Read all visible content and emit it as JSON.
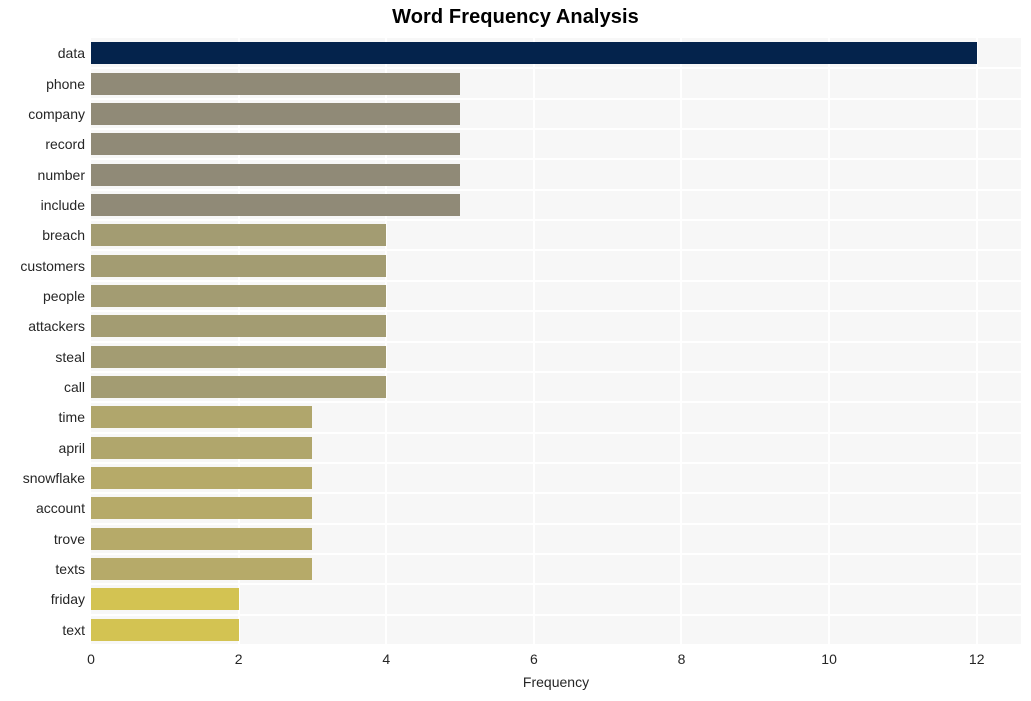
{
  "chart_data": {
    "type": "bar",
    "orientation": "horizontal",
    "title": "Word Frequency Analysis",
    "xlabel": "Frequency",
    "ylabel": "",
    "xlim": [
      0,
      12.6
    ],
    "xticks": [
      0,
      2,
      4,
      6,
      8,
      10,
      12
    ],
    "xtick_labels": [
      "0",
      "2",
      "4",
      "6",
      "8",
      "10",
      "12"
    ],
    "grid": true,
    "legend": null,
    "categories": [
      "data",
      "phone",
      "company",
      "record",
      "number",
      "include",
      "breach",
      "customers",
      "people",
      "attackers",
      "steal",
      "call",
      "time",
      "april",
      "snowflake",
      "account",
      "trove",
      "texts",
      "friday",
      "text"
    ],
    "values": [
      12,
      5,
      5,
      5,
      5,
      5,
      4,
      4,
      4,
      4,
      4,
      4,
      3,
      3,
      3,
      3,
      3,
      3,
      2,
      2
    ],
    "bar_colors": [
      "#04234c",
      "#908a77",
      "#908a77",
      "#908a77",
      "#908a77",
      "#908a77",
      "#a39c72",
      "#a39c72",
      "#a39c72",
      "#a39c72",
      "#a39c72",
      "#a39c72",
      "#b0a66c",
      "#b0a66c",
      "#b6aa69",
      "#b6aa69",
      "#b6aa69",
      "#b6aa69",
      "#d3c352",
      "#d3c352"
    ],
    "plot_background": "#f7f7f7",
    "gridline_color": "#ffffff",
    "title_color": "#000000",
    "tick_label_color": "#262626"
  }
}
